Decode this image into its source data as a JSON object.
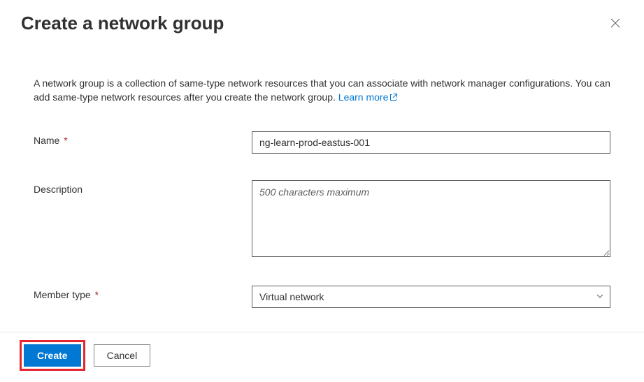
{
  "header": {
    "title": "Create a network group"
  },
  "intro": {
    "text": "A network group is a collection of same-type network resources that you can associate with network manager configurations. You can add same-type network resources after you create the network group. ",
    "learn_more": "Learn more"
  },
  "form": {
    "name_label": "Name",
    "name_value": "ng-learn-prod-eastus-001",
    "description_label": "Description",
    "description_placeholder": "500 characters maximum",
    "description_value": "",
    "member_type_label": "Member type",
    "member_type_value": "Virtual network"
  },
  "footer": {
    "create": "Create",
    "cancel": "Cancel"
  }
}
